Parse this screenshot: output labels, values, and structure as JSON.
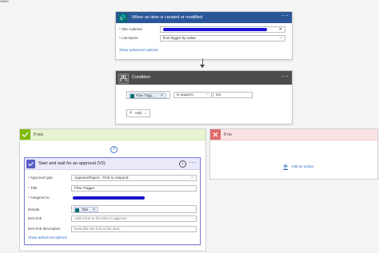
{
  "top_label": "value",
  "trigger": {
    "title": "When an item is created or modified",
    "site_address_label": "* Site Address",
    "list_name_label": "* List Name",
    "list_name_value": "flow trigger by value",
    "show_advanced": "Show advanced options",
    "menu": "···",
    "clear_icon": "✕",
    "dropdown_icon": "⌵"
  },
  "condition": {
    "title": "Condition",
    "token_label": "Flow Trigg...",
    "token_close": "×",
    "operator": "is equal to",
    "value": "Go",
    "add_label": "Add",
    "add_plus": "+",
    "menu": "···"
  },
  "if_yes": {
    "title": "If yes",
    "plus": "+",
    "action": {
      "title": "Start and wait for an approval (V2)",
      "info": "i",
      "menu": "···",
      "approval_type_label": "* Approval type",
      "approval_type_value": "Approve/Reject - First to respond",
      "title_label": "* Title",
      "title_value": "Flow Trigger",
      "assigned_label": "* Assigned to",
      "details_label": "Details",
      "details_token": "Title",
      "details_token_close": "×",
      "item_link_label": "Item link",
      "item_link_placeholder": "Add a link to the item to approve",
      "item_link_desc_label": "Item link description",
      "item_link_desc_placeholder": "Describe the link to the item",
      "show_advanced": "Show advanced options"
    }
  },
  "if_no": {
    "title": "If no",
    "add_action": "Add an action"
  },
  "colors": {
    "trigger_header": "#2b579a",
    "condition_header": "#4d4d4d",
    "if_yes_accent": "#7fba00",
    "if_no_accent": "#e06c6c",
    "approval_header": "#5b5fc7",
    "link": "#2a6cc4"
  }
}
